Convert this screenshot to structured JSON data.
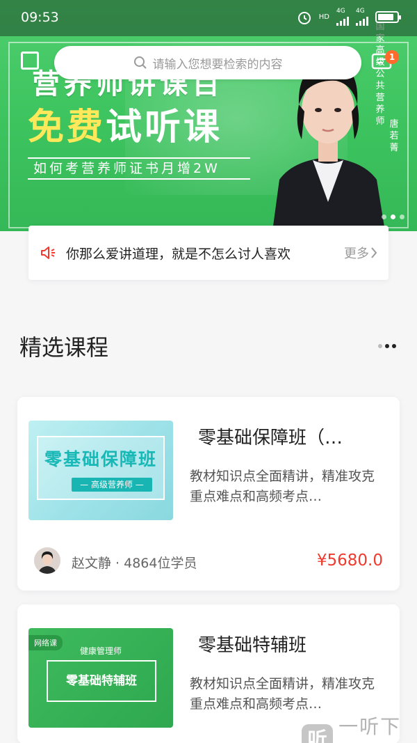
{
  "status_bar": {
    "time": "09:53",
    "net1": "4G",
    "net2": "4G",
    "hd": "HD"
  },
  "banner": {
    "partial_title": "营养师讲课百",
    "free_yellow": "免费",
    "free_white": "试听课",
    "subtitle": "如何考营养师证书月增2W",
    "vertical_tag": "国家高级公共营养师",
    "teacher_name": "唐若菁",
    "slides_total": 3,
    "active_slide": 2
  },
  "search": {
    "placeholder": "请输入您想要检索的内容"
  },
  "messages": {
    "badge": "1"
  },
  "notice": {
    "text": "你那么爱讲道理，就是不怎么讨人喜欢",
    "more": "更多"
  },
  "section": {
    "title": "精选课程"
  },
  "courses": [
    {
      "thumb_title": "零基础保障班",
      "thumb_sub": "— 高级营养师 —",
      "title": "零基础保障班（…",
      "desc": "教材知识点全面精讲，精准攻克重点难点和高频考点…",
      "teacher": "赵文静 · 4864位学员",
      "price": "¥5680.0"
    },
    {
      "thumb_tag": "网络课",
      "thumb_top": "健康管理师",
      "thumb_title": "零基础特辅班",
      "title": "零基础特辅班",
      "desc": "教材知识点全面精讲，精准攻克重点难点和高频考点…"
    }
  ],
  "watermark": {
    "logo": "听",
    "text": "一听下载"
  },
  "colors": {
    "brand_green": "#3cc35e",
    "price_red": "#ee3b2f",
    "badge_orange": "#ff6b2c"
  }
}
